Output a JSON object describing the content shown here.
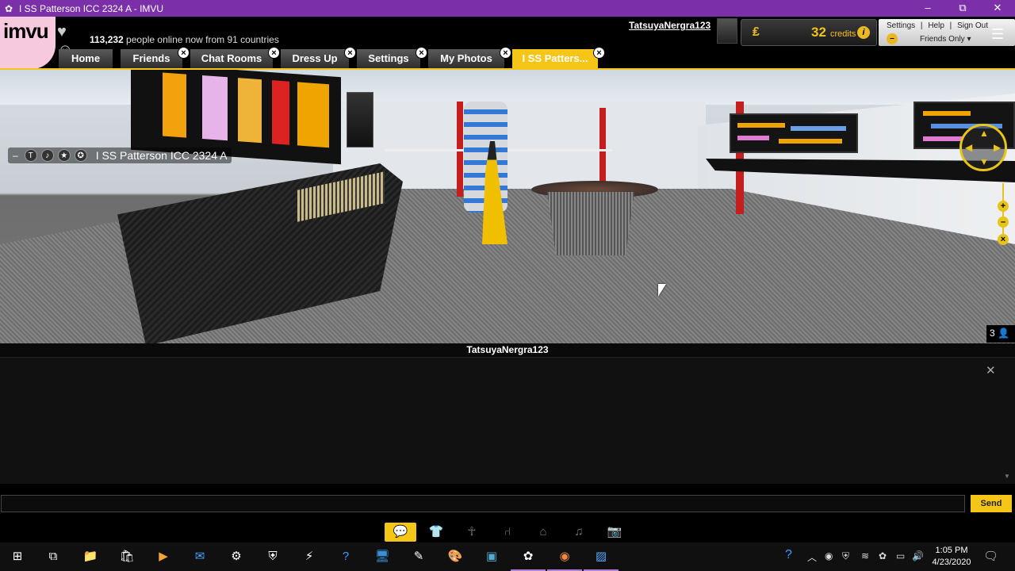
{
  "window": {
    "title": "I SS  Patterson  ICC  2324  A - IMVU",
    "minimize": "–",
    "maximize": "⧉",
    "close": "✕"
  },
  "header": {
    "logo_text": "imvu",
    "online_count": "113,232",
    "online_suffix": " people online now from 91 countries",
    "username": "TatsuyaNergra123",
    "credits_value": "32",
    "credits_label": "credits",
    "links": [
      "Settings",
      "Help",
      "Sign Out"
    ],
    "link_sep": "|",
    "status": "Friends Only"
  },
  "tabs": [
    {
      "label": "Home",
      "closable": false
    },
    {
      "label": "Friends",
      "closable": true
    },
    {
      "label": "Chat Rooms",
      "closable": true
    },
    {
      "label": "Dress Up",
      "closable": true
    },
    {
      "label": "Settings",
      "closable": true
    },
    {
      "label": "My Photos",
      "closable": true
    },
    {
      "label": "I SS Patters...",
      "closable": true,
      "active": true
    }
  ],
  "room": {
    "name": "I SS Patterson ICC 2324 A",
    "occupants": "3"
  },
  "chat": {
    "title": "TatsuyaNergra123",
    "input_value": "",
    "send_label": "Send"
  },
  "colors": {
    "accent": "#f5c518",
    "titlebar": "#7b2fa8"
  },
  "modes": [
    {
      "icon": "chat-bubble-icon",
      "active": true
    },
    {
      "icon": "shirt-icon"
    },
    {
      "icon": "avatar-pose-icon"
    },
    {
      "icon": "chair-icon"
    },
    {
      "icon": "house-icon"
    },
    {
      "icon": "music-icon"
    },
    {
      "icon": "camera-icon"
    }
  ],
  "taskbar": {
    "time": "1:05 PM",
    "date": "4/23/2020"
  }
}
